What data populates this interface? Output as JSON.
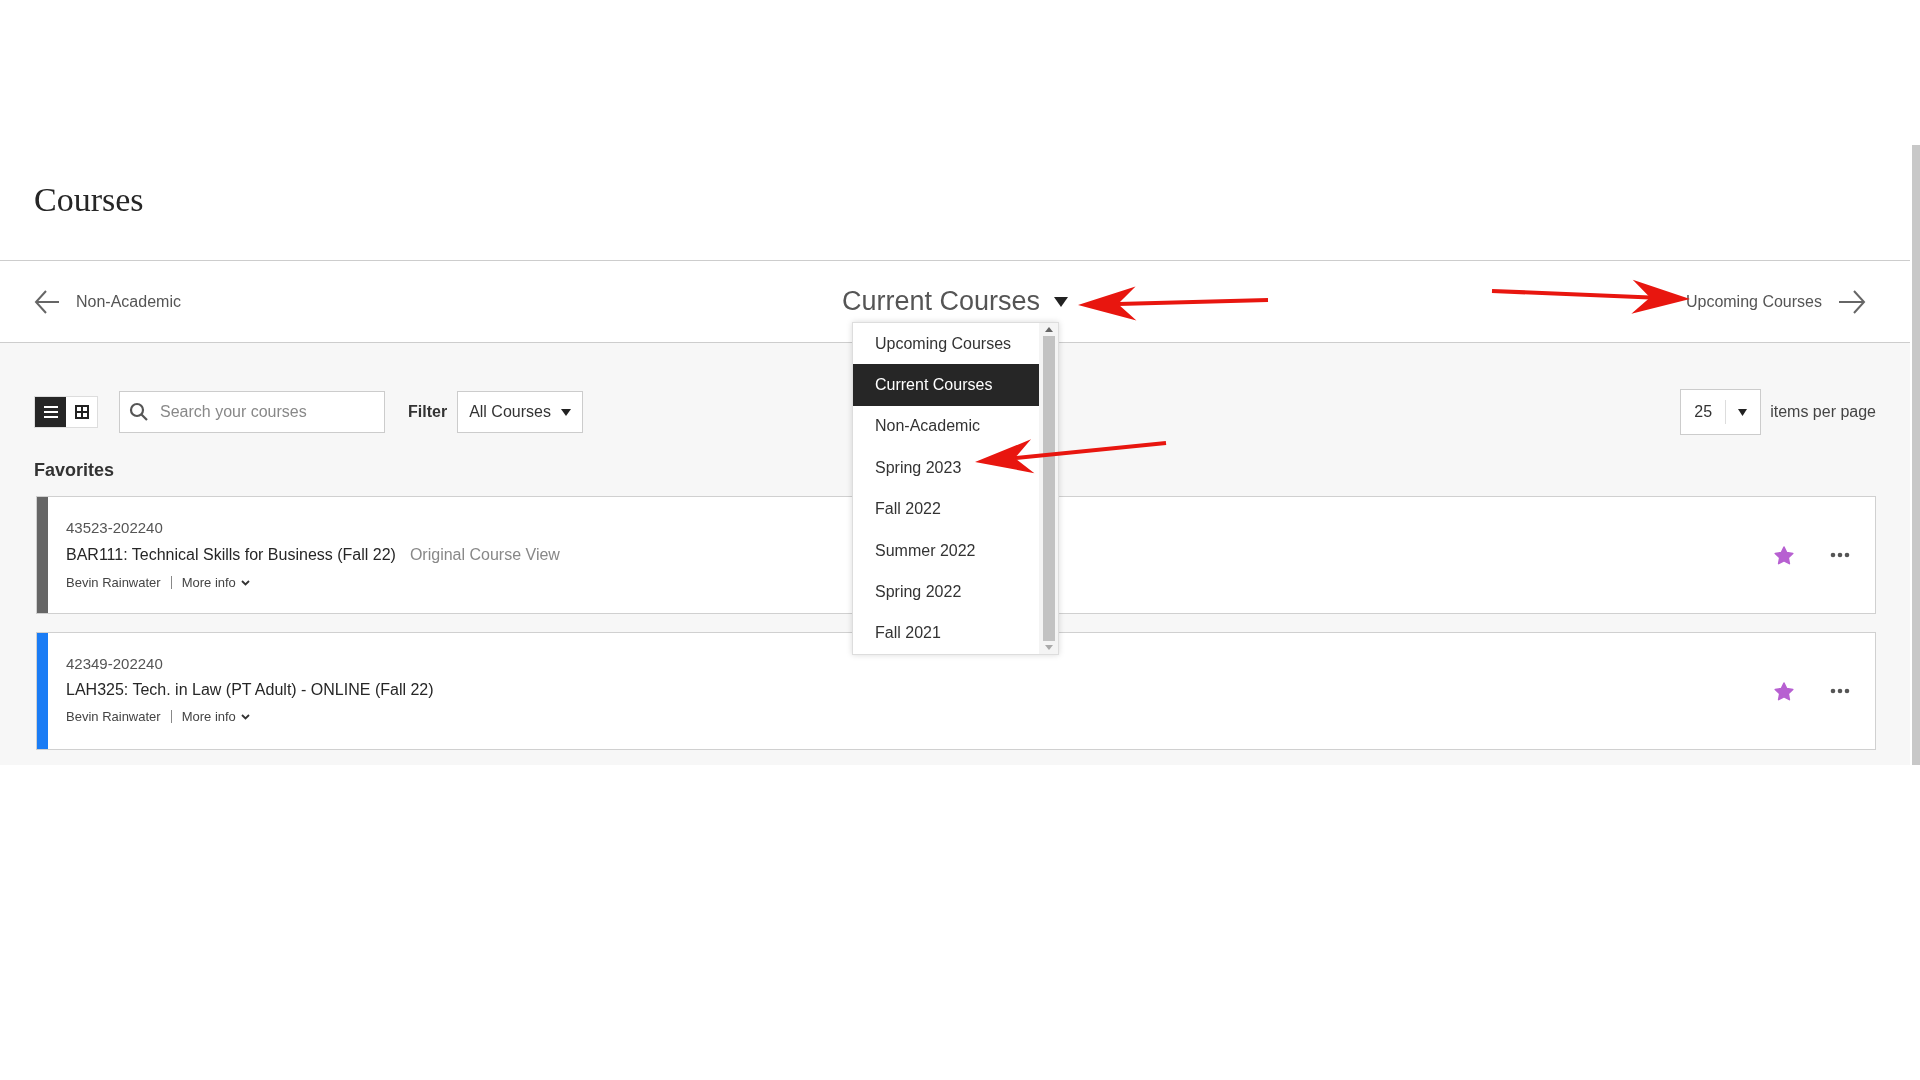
{
  "page_title": "Courses",
  "term_nav": {
    "previous": "Non-Academic",
    "current": "Current Courses",
    "next": "Upcoming Courses"
  },
  "term_menu": [
    {
      "label": "Upcoming Courses",
      "selected": false
    },
    {
      "label": "Current Courses",
      "selected": true
    },
    {
      "label": "Non-Academic",
      "selected": false
    },
    {
      "label": "Spring 2023",
      "selected": false
    },
    {
      "label": "Fall 2022",
      "selected": false
    },
    {
      "label": "Summer 2022",
      "selected": false
    },
    {
      "label": "Spring 2022",
      "selected": false
    },
    {
      "label": "Fall 2021",
      "selected": false
    }
  ],
  "view_toggle": [
    {
      "kind": "list",
      "selected": true
    },
    {
      "kind": "grid",
      "selected": false
    }
  ],
  "search": {
    "placeholder": "Search your courses"
  },
  "filter": {
    "label": "Filter",
    "value": "All Courses"
  },
  "paging": {
    "value": "25",
    "label": "items per page"
  },
  "section_title": "Favorites",
  "courses": [
    {
      "code": "43523-202240",
      "title": "BAR111: Technical Skills for Business (Fall 22)",
      "tag": "Original Course View",
      "instructor": "Bevin Rainwater",
      "more": "More info",
      "color": "#666666",
      "favorite": true
    },
    {
      "code": "42349-202240",
      "title": "LAH325: Tech. in Law (PT Adult) - ONLINE (Fall 22)",
      "instructor": "Bevin Rainwater",
      "more": "More info",
      "color": "#1a7cf5",
      "favorite": true
    }
  ]
}
